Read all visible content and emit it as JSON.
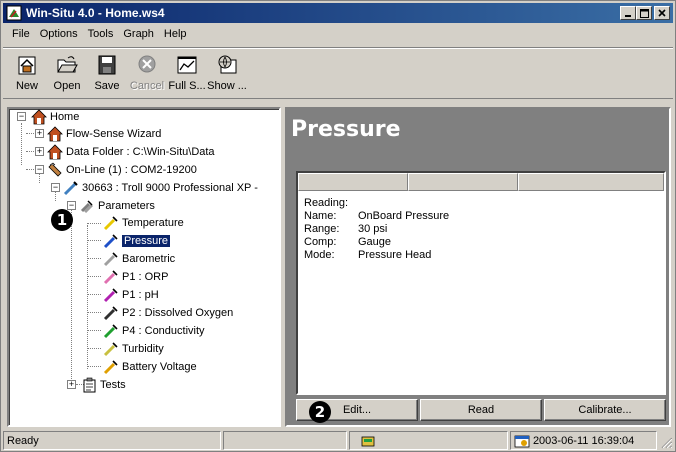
{
  "window": {
    "title": "Win-Situ 4.0 - Home.ws4"
  },
  "menu": [
    "File",
    "Options",
    "Tools",
    "Graph",
    "Help"
  ],
  "toolbar": {
    "new": "New",
    "open": "Open",
    "save": "Save",
    "cancel": "Cancel",
    "fullscreen": "Full S...",
    "show": "Show ..."
  },
  "tree": {
    "home": "Home",
    "wizard": "Flow-Sense Wizard",
    "data_folder": "Data Folder : C:\\Win-Situ\\Data",
    "online": "On-Line (1) : COM2-19200",
    "device": "30663 : Troll 9000 Professional XP -",
    "parameters": "Parameters",
    "params": [
      {
        "label": "Temperature",
        "color": "#e8c800"
      },
      {
        "label": "Pressure",
        "color": "#1e50c8"
      },
      {
        "label": "Barometric",
        "color": "#a0a0a0"
      },
      {
        "label": "P1 : ORP",
        "color": "#e070b0"
      },
      {
        "label": "P1 : pH",
        "color": "#b020b0"
      },
      {
        "label": "P2 : Dissolved Oxygen",
        "color": "#303030"
      },
      {
        "label": "P4 : Conductivity",
        "color": "#20a030"
      },
      {
        "label": "Turbidity",
        "color": "#c8c040"
      },
      {
        "label": "Battery Voltage",
        "color": "#e0a000"
      }
    ],
    "tests": "Tests"
  },
  "detail": {
    "title": "Pressure",
    "reading_label": "Reading:",
    "rows": [
      {
        "k": "Name:",
        "v": "OnBoard Pressure"
      },
      {
        "k": "Range:",
        "v": "30 psi"
      },
      {
        "k": "Comp:",
        "v": "Gauge"
      },
      {
        "k": "Mode:",
        "v": "Pressure Head"
      }
    ],
    "buttons": {
      "edit": "Edit...",
      "read": "Read",
      "calibrate": "Calibrate..."
    }
  },
  "callouts": {
    "one": "1",
    "two": "2"
  },
  "status": {
    "ready": "Ready",
    "datetime": "2003-06-11  16:39:04"
  }
}
